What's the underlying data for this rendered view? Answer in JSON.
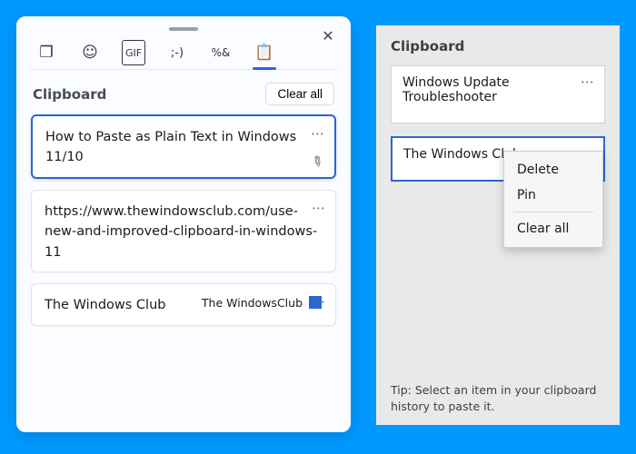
{
  "left": {
    "close_glyph": "✕",
    "tabs": [
      {
        "name": "recent",
        "glyph": "❐"
      },
      {
        "name": "emoji",
        "glyph": "☺"
      },
      {
        "name": "gif",
        "glyph": "GIF"
      },
      {
        "name": "kaomoji",
        "glyph": ";-)"
      },
      {
        "name": "symbols",
        "glyph": "%&"
      },
      {
        "name": "clipboard",
        "glyph": "📋"
      }
    ],
    "active_tab": "clipboard",
    "section_title": "Clipboard",
    "clear_all_label": "Clear all",
    "items": [
      {
        "text": "How to Paste as Plain Text in Windows 11/10",
        "selected": true,
        "pinnable": true
      },
      {
        "text": "https://www.thewindowsclub.com/use-new-and-improved-clipboard-in-windows-11",
        "selected": false,
        "pinnable": false
      },
      {
        "text": "The Windows Club",
        "selected": false,
        "thumb": "The WindowsClub"
      }
    ]
  },
  "right": {
    "title": "Clipboard",
    "items": [
      {
        "text": "Windows Update Troubleshooter",
        "selected": false
      },
      {
        "text": "The Windows Club",
        "selected": true
      }
    ],
    "menu": {
      "delete": "Delete",
      "pin": "Pin",
      "clear_all": "Clear all"
    },
    "tip": "Tip: Select an item in your clipboard history to paste it."
  }
}
